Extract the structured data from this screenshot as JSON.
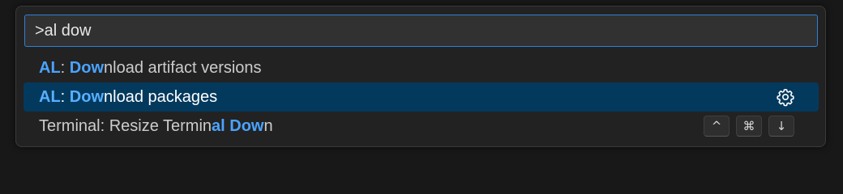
{
  "search": {
    "value": ">al dow"
  },
  "results": [
    {
      "category": "AL",
      "sep": ": ",
      "match": "Dow",
      "rest": "nload artifact versions",
      "selected": false
    },
    {
      "category": "AL",
      "sep": ": ",
      "match": "Dow",
      "rest": "nload packages",
      "selected": true,
      "icon": "gear-icon"
    },
    {
      "prefix": "Terminal: Resize Termin",
      "match": "al Dow",
      "rest": "n",
      "keybinding": [
        "^",
        "⌘",
        "↓"
      ]
    }
  ],
  "colors": {
    "highlight": "#4aa3ff",
    "selected_bg": "#04395e",
    "input_border": "#2f7fd6"
  }
}
